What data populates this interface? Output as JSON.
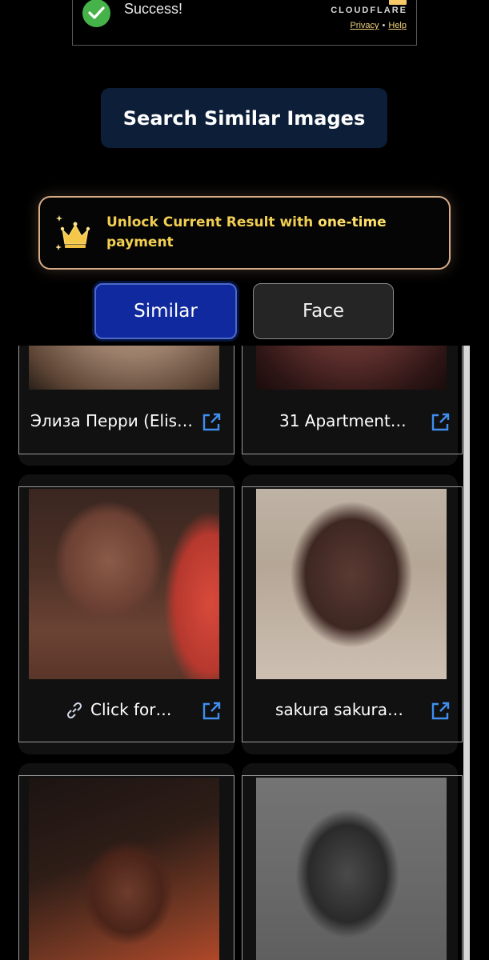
{
  "cloudflare": {
    "status_text": "Success!",
    "logo_text": "CLOUDFLARE",
    "privacy_link": "Privacy",
    "separator": "•",
    "help_link": "Help"
  },
  "search_button": {
    "label": "Search Similar Images"
  },
  "unlock_banner": {
    "text_prefix": "Unlock Current Result with ",
    "text_strong": "one-time",
    "text_suffix": "payment",
    "icon": "crown-icon"
  },
  "tabs": [
    {
      "label": "Similar",
      "active": true
    },
    {
      "label": "Face",
      "active": false
    }
  ],
  "results": [
    {
      "title": "Элиза Перри (Elis…",
      "has_link_icon": false
    },
    {
      "title": "31 Apartment…",
      "has_link_icon": false
    },
    {
      "title": "Click for…",
      "has_link_icon": true
    },
    {
      "title": "sakura sakura…",
      "has_link_icon": false
    },
    {
      "title": "",
      "has_link_icon": false
    },
    {
      "title": "",
      "has_link_icon": false
    }
  ],
  "colors": {
    "accent_blue": "#10299e",
    "search_button_bg": "#0c1e38",
    "banner_border": "#d7ab86",
    "banner_text": "#f1cf52",
    "external_link_icon": "#3f8ef0",
    "success_green": "#46b34a"
  }
}
